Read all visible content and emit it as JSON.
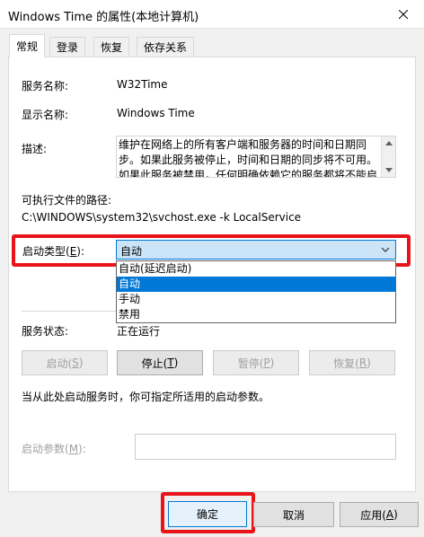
{
  "window": {
    "title": "Windows Time 的属性(本地计算机)"
  },
  "tabs": [
    {
      "label": "常规",
      "active": true
    },
    {
      "label": "登录",
      "active": false
    },
    {
      "label": "恢复",
      "active": false
    },
    {
      "label": "依存关系",
      "active": false
    }
  ],
  "general": {
    "service_name_label": "服务名称:",
    "service_name_value": "W32Time",
    "display_name_label": "显示名称:",
    "display_name_value": "Windows Time",
    "description_label": "描述:",
    "description_value": "维护在网络上的所有客户端和服务器的时间和日期同步。如果此服务被停止，时间和日期的同步将不可用。如果此服务被禁用，任何明确依赖它的服务都将不能启动。",
    "exe_path_label": "可执行文件的路径:",
    "exe_path_value": "C:\\WINDOWS\\system32\\svchost.exe -k LocalService",
    "startup_type_label": "启动类型(E):",
    "startup_type_label_prefix": "启动类型(",
    "startup_type_label_key": "E",
    "startup_type_label_suffix": "):",
    "startup_type_value": "自动",
    "startup_options": [
      "自动(延迟启动)",
      "自动",
      "手动",
      "禁用"
    ],
    "startup_selected_index": 1,
    "service_status_label": "服务状态:",
    "service_status_value": "正在运行",
    "hint_text": "当从此处启动服务时，你可指定所适用的启动参数。",
    "start_params_label_prefix": "启动参数(",
    "start_params_label_key": "M",
    "start_params_label_suffix": "):",
    "start_params_value": ""
  },
  "service_buttons": {
    "start": {
      "prefix": "启动(",
      "key": "S",
      "suffix": ")"
    },
    "stop": {
      "prefix": "停止(",
      "key": "T",
      "suffix": ")"
    },
    "pause": {
      "prefix": "暂停(",
      "key": "P",
      "suffix": ")"
    },
    "resume": {
      "prefix": "恢复(",
      "key": "R",
      "suffix": ")"
    }
  },
  "footer": {
    "ok_label": "确定",
    "cancel_label": "取消",
    "apply_prefix": "应用(",
    "apply_key": "A",
    "apply_suffix": ")"
  },
  "colors": {
    "highlight_red": "#e8141a",
    "selection_blue": "#0078d7"
  }
}
